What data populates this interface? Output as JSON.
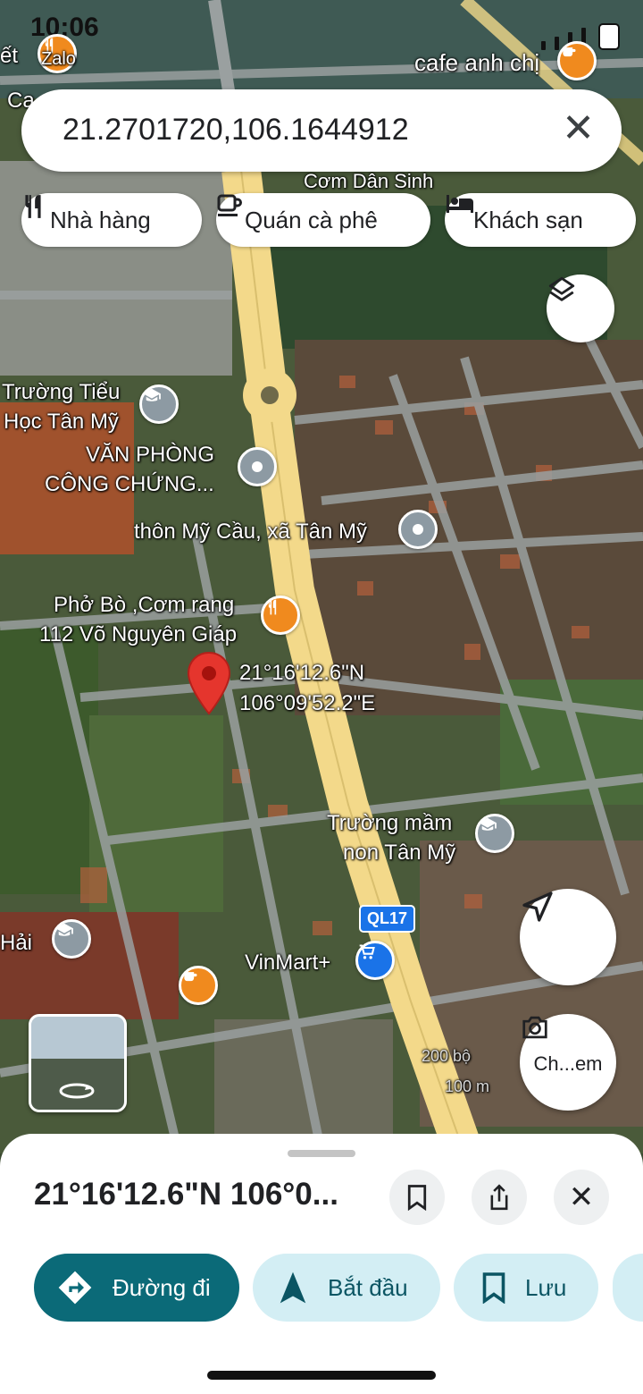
{
  "status_bar": {
    "time": "10:06"
  },
  "search": {
    "query": "21.2701720,106.1644912"
  },
  "chips": [
    {
      "label": "Nhà hàng",
      "icon": "restaurant-icon"
    },
    {
      "label": "Quán cà phê",
      "icon": "coffee-icon"
    },
    {
      "label": "Khách sạn",
      "icon": "hotel-icon"
    }
  ],
  "map_labels": {
    "top_left_a": "ết",
    "top_left_b": "Zalo",
    "top_left_c": "Ca",
    "cafe_anh_chi": "cafe anh chị",
    "road_top": "Cơm Dân Sinh",
    "school1_line1": "Trường Tiểu",
    "school1_line2": "Học Tân Mỹ",
    "office_line1": "VĂN PHÒNG",
    "office_line2": "CÔNG CHỨNG...",
    "village": "thôn Mỹ Cầu, xã Tân Mỹ",
    "pho_line1": "Phở Bò ,Cơm rang",
    "pho_line2": "112 Võ Nguyên Giáp",
    "coord_line1": "21°16'12.6\"N",
    "coord_line2": "106°09'52.2\"E",
    "kinder_line1": "Trường mầm",
    "kinder_line2": "non Tân Mỹ",
    "hai": "Hải",
    "road_badge": "QL17",
    "vinmart": "VinMart+",
    "scale_1": "200 bộ",
    "scale_2": "100 m"
  },
  "buttons": {
    "lens_label": "Ch...em"
  },
  "sheet": {
    "title": "21°16'12.6\"N 106°0..."
  },
  "actions": [
    {
      "label": "Đường đi",
      "style": "primary"
    },
    {
      "label": "Bắt đầu",
      "style": "tonal"
    },
    {
      "label": "Lưu",
      "style": "tonal"
    }
  ],
  "colors": {
    "primary": "#0b6a78",
    "tonal": "#d3eef4",
    "tonal_text": "#0b5563",
    "pin_red": "#e5352d",
    "pin_orange": "#f08a1e",
    "pin_gray": "#8d9aa3",
    "pin_blue": "#1a73e8",
    "road": "#f3d98a"
  }
}
